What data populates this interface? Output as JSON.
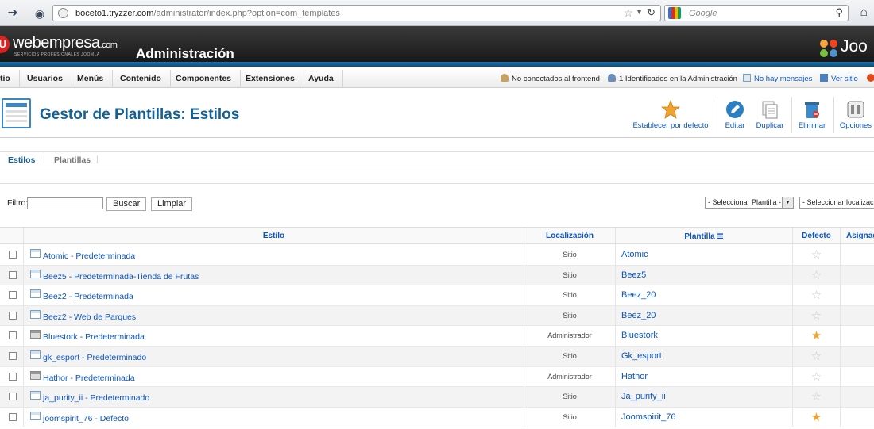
{
  "browser": {
    "url_host": "boceto1.tryzzer.com",
    "url_path": "/administrator/index.php?option=com_templates",
    "search_placeholder": "Google"
  },
  "header": {
    "brand": "webempresa",
    "brand_suffix": ".com",
    "brand_sub": "SERVICIOS PROFESIONALES JOOMLA",
    "title": "Administración",
    "joomla_text": "Joo"
  },
  "menu": {
    "items": [
      "tio",
      "Usuarios",
      "Menús",
      "Contenido",
      "Componentes",
      "Extensiones",
      "Ayuda"
    ],
    "status_frontend": "No conectados al frontend",
    "status_admin": "1 Identificados en la Administración",
    "status_messages": "No hay mensajes",
    "status_site": "Ver sitio"
  },
  "toolbar": {
    "page_title": "Gestor de Plantillas: Estilos",
    "buttons": {
      "default": "Establecer por defecto",
      "edit": "Editar",
      "duplicate": "Duplicar",
      "delete": "Eliminar",
      "options": "Opciones"
    }
  },
  "submenu": {
    "styles": "Estilos",
    "templates": "Plantillas"
  },
  "filter": {
    "label": "Filtro:",
    "value": "",
    "search_button": "Buscar",
    "clear_button": "Limpiar",
    "select_template": "- Seleccionar Plantilla -",
    "select_location": "- Seleccionar localización -"
  },
  "table": {
    "headers": {
      "style": "Estilo",
      "location": "Localización",
      "template": "Plantilla",
      "default": "Defecto",
      "assigned": "Asignado"
    },
    "rows": [
      {
        "style": "Atomic - Predeterminada",
        "location": "Sitio",
        "template": "Atomic",
        "is_default": false,
        "admin": false
      },
      {
        "style": "Beez5 - Predeterminada-Tienda de Frutas",
        "location": "Sitio",
        "template": "Beez5",
        "is_default": false,
        "admin": false
      },
      {
        "style": "Beez2 - Predeterminada",
        "location": "Sitio",
        "template": "Beez_20",
        "is_default": false,
        "admin": false
      },
      {
        "style": "Beez2 - Web de Parques",
        "location": "Sitio",
        "template": "Beez_20",
        "is_default": false,
        "admin": false
      },
      {
        "style": "Bluestork - Predeterminada",
        "location": "Administrador",
        "template": "Bluestork",
        "is_default": true,
        "admin": true
      },
      {
        "style": "gk_esport - Predeterminado",
        "location": "Sitio",
        "template": "Gk_esport",
        "is_default": false,
        "admin": false
      },
      {
        "style": "Hathor - Predeterminada",
        "location": "Administrador",
        "template": "Hathor",
        "is_default": false,
        "admin": true
      },
      {
        "style": "ja_purity_ii - Predeterminado",
        "location": "Sitio",
        "template": "Ja_purity_ii",
        "is_default": false,
        "admin": false
      },
      {
        "style": "joomspirit_76 - Defecto",
        "location": "Sitio",
        "template": "Joomspirit_76",
        "is_default": true,
        "admin": false
      }
    ]
  },
  "colors": {
    "link": "#0b55c4",
    "title": "#146295",
    "star_on": "#f2a22e",
    "star_off": "#c8c8c8"
  }
}
